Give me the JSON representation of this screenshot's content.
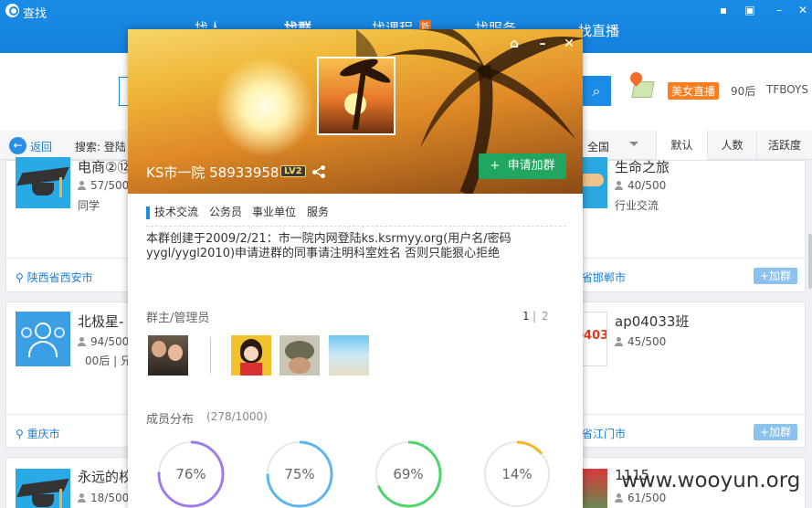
{
  "app": {
    "title": "查找",
    "tabs": [
      {
        "label": "找人"
      },
      {
        "label": "找群"
      },
      {
        "label": "找课程"
      },
      {
        "label": "找服务"
      },
      {
        "label": "找直播"
      }
    ],
    "new_badge": "新",
    "window_buttons": [
      "msg-icon",
      "lock-icon",
      "minimize-icon",
      "close-icon"
    ]
  },
  "search": {
    "hot_badge": "美女直播",
    "hot_items": [
      "90后",
      "TFBOYS"
    ]
  },
  "toolbar": {
    "back_label": "返回",
    "search_label": "搜索: 登陆",
    "region": "全国",
    "sort_tabs": [
      "默认",
      "人数",
      "活跃度"
    ],
    "active_sort": "默认"
  },
  "cards": [
    {
      "name": "电商②⑫班",
      "members": "57/500",
      "tag": "同学",
      "location": "陕西省西安市",
      "icon": "graduation-cap-icon"
    },
    {
      "name": "北极星-",
      "members": "94/500",
      "tag": "00后 | 兄",
      "location": "重庆市",
      "icon": "group-people-icon"
    },
    {
      "name": "永远的校",
      "members": "18/500",
      "tag": "",
      "location": "",
      "icon": "graduation-cap-icon"
    },
    {
      "name": "生命之旅",
      "members": "40/500",
      "tag": "行业交流",
      "location": "省邯郸市",
      "icon": "handshake-icon",
      "join": "+加群"
    },
    {
      "name": "ap04033班",
      "members": "45/500",
      "tag": "",
      "location": "省江门市",
      "icon": "class-logo-icon",
      "logo_text": "04033",
      "join": "+加群"
    },
    {
      "name": "1115",
      "members": "61/500",
      "tag": "",
      "location": "",
      "icon": "photo-icon"
    }
  ],
  "popup": {
    "group_name": "KS市一院 58933958",
    "level": "LV2",
    "apply_label": "申请加群",
    "tags": [
      "技术交流",
      "公务员",
      "事业单位",
      "服务"
    ],
    "intro_line1": "本群创建于2009/2/21：市一院内网登陆ks.ksrmyy.org(用户名/密码",
    "intro_line2": "yygl/yygl2010)申请进群的同事请注明科室姓名 否则只能狠心拒绝",
    "admins_title": "群主/管理员",
    "pages": [
      "1",
      "2"
    ],
    "members_title": "成员分布",
    "member_count": "(278/1000)",
    "distribution": [
      {
        "label": "76%",
        "value": 76,
        "color": "#a07de6"
      },
      {
        "label": "75%",
        "value": 75,
        "color": "#5bb6ef"
      },
      {
        "label": "69%",
        "value": 69,
        "color": "#4fd36a"
      },
      {
        "label": "14%",
        "value": 14,
        "color": "#f2b824"
      }
    ]
  },
  "watermark": "www.wooyun.org"
}
